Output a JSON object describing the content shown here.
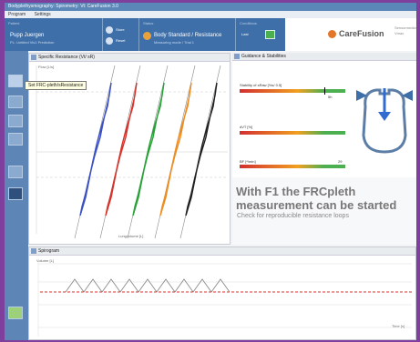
{
  "window": {
    "title": "Bodyplethysmography: Spirometry: Vt: CareFusion 3.0",
    "menu": [
      "Program",
      "Settings"
    ]
  },
  "header": {
    "patient_label": "Patient",
    "patient_value": "Pupp Juergen",
    "patient_sub": "PL:  Untitled  Vis1  Prediction",
    "actions": [
      "Store",
      "Reset"
    ],
    "status_label": "Status",
    "status_value": "Body Standard / Resistance",
    "status_sub": "Measuring mode / Trial 1",
    "conditions_label": "Conditions",
    "conditions_value": "Last",
    "brand": "CareFusion",
    "right_text": "Sensormedics  Vmax"
  },
  "tooltip": "Set FRC-pleth/sResistance",
  "resistance_panel": {
    "title": "Specific Resistance (Vt/ sR)",
    "y_label": "Flow [L/s]",
    "x_label": "Lungvolume [L]",
    "loop_colors": [
      "#3b50c4",
      "#d8322a",
      "#27a336",
      "#f08c1e",
      "#202020"
    ]
  },
  "guidance_panel": {
    "title": "Guidance & Stabilities",
    "gauges": [
      {
        "label": "Stability of sRaw [%s/ 0.5]",
        "value_text": "5h",
        "marker": 0.8
      },
      {
        "label": "dVT [%]",
        "value_text": "",
        "marker": 0.62
      },
      {
        "label": "BF [*/min]",
        "value_text": "29",
        "marker": 0.72
      }
    ],
    "message_title": "With F1 the FRCpleth measurement can be started",
    "message_sub": "Check for reproducible resistance loops"
  },
  "spirogram_panel": {
    "title": "Spirogram",
    "y_label": "Volume [L]",
    "x_label": "Time [s]",
    "colors": {
      "trace": "#8a8a8a",
      "baseline": "#d8322a"
    }
  },
  "colors": {
    "accent": "#3f6fa8",
    "brand": "#e2772a",
    "frame": "#7f3f9c"
  }
}
